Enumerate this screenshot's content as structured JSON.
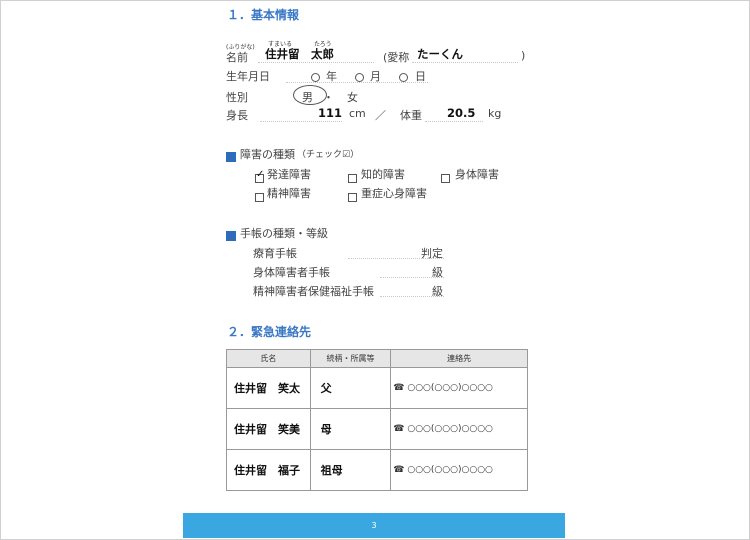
{
  "section1": {
    "title": "１．基本情報",
    "furigana_label": "(ふりがな)",
    "name_label": "名前",
    "name_ruby_family": "すまいる",
    "name_ruby_given": "たろう",
    "name_family": "住井留",
    "name_given": "太郎",
    "nickname_open": "(愛称",
    "nickname": "たーくん",
    "nickname_close": ")",
    "birthday_label": "生年月日",
    "year_unit": "年",
    "month_unit": "月",
    "day_unit": "日",
    "gender_label": "性別",
    "gender_male": "男",
    "gender_dot": "・",
    "gender_female": "女",
    "gender_selected": "男",
    "height_label": "身長",
    "height_value": "111",
    "height_unit": "cm",
    "separator": "／",
    "weight_label": "体重",
    "weight_value": "20.5",
    "weight_unit": "kg"
  },
  "disability": {
    "heading": "障害の種類",
    "note": "（チェック☑）",
    "items": [
      {
        "label": "発達障害",
        "checked": true
      },
      {
        "label": "知的障害",
        "checked": false
      },
      {
        "label": "身体障害",
        "checked": false
      },
      {
        "label": "精神障害",
        "checked": false
      },
      {
        "label": "重症心身障害",
        "checked": false
      }
    ]
  },
  "handbook": {
    "heading": "手帳の種類・等級",
    "rows": [
      {
        "label": "療育手帳",
        "unit": "判定"
      },
      {
        "label": "身体障害者手帳",
        "unit": "級"
      },
      {
        "label": "精神障害者保健福祉手帳",
        "unit": "級"
      }
    ]
  },
  "section2": {
    "title": "２．緊急連絡先",
    "headers": [
      "氏名",
      "続柄・所属等",
      "連絡先"
    ],
    "rows": [
      {
        "name": "住井留　笑太",
        "relation": "父",
        "phone": "☎ ○○○(○○○)○○○○"
      },
      {
        "name": "住井留　笑美",
        "relation": "母",
        "phone": "☎ ○○○(○○○)○○○○"
      },
      {
        "name": "住井留　福子",
        "relation": "祖母",
        "phone": "☎ ○○○(○○○)○○○○"
      }
    ]
  },
  "footer": {
    "page_number": "3"
  },
  "colors": {
    "accent": "#3a78c6",
    "bullet": "#2e6bb8",
    "footer": "#3aa7e0"
  }
}
